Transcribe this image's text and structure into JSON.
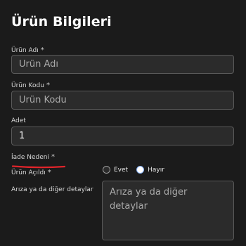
{
  "form": {
    "title": "Ürün Bilgileri",
    "required_mark": "*",
    "product_name": {
      "label": "Ürün Adı",
      "placeholder": "Ürün Adı",
      "value": ""
    },
    "product_code": {
      "label": "Ürün Kodu",
      "placeholder": "Ürün Kodu",
      "value": ""
    },
    "quantity": {
      "label": "Adet",
      "value": "1"
    },
    "return_reason": {
      "label": "İade Nedeni"
    },
    "product_opened": {
      "label": "Ürün Açıldı",
      "options": [
        {
          "label": "Evet",
          "selected": false
        },
        {
          "label": "Hayır",
          "selected": true
        }
      ]
    },
    "fault_details": {
      "label": "Arıza ya da diğer detaylar",
      "placeholder": "Arıza ya da diğer detaylar",
      "value": ""
    }
  },
  "colors": {
    "background": "#1b1b1b",
    "input_background": "#2b2b2b",
    "annotation_underline": "#e0242a",
    "selected_radio_ring": "#8ab4f8"
  }
}
